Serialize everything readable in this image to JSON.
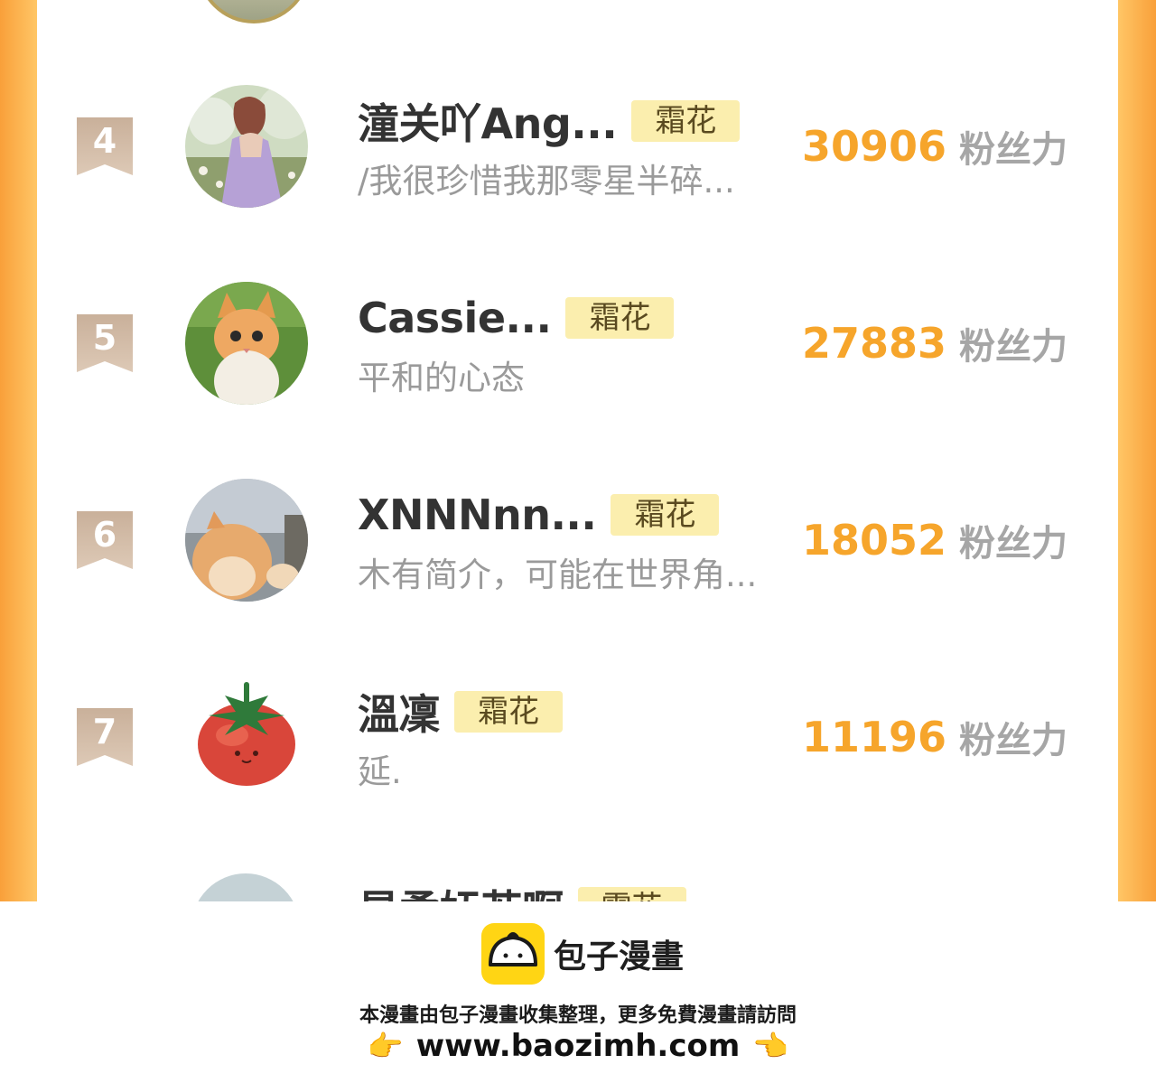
{
  "leaderboard": [
    {
      "rank": "4",
      "name": "潼关吖Ang...",
      "tag": "霜花",
      "bio": "/我很珍惜我那零星半碎...",
      "score": "30906",
      "unit": "粉丝力"
    },
    {
      "rank": "5",
      "name": "Cassie...",
      "tag": "霜花",
      "bio": "平和的心态",
      "score": "27883",
      "unit": "粉丝力"
    },
    {
      "rank": "6",
      "name": "XNNNnn...",
      "tag": "霜花",
      "bio": "木有简介，可能在世界角...",
      "score": "18052",
      "unit": "粉丝力"
    },
    {
      "rank": "7",
      "name": "溫凜",
      "tag": "霜花",
      "bio": "延.",
      "score": "11196",
      "unit": "粉丝力"
    }
  ],
  "partial_row": {
    "name": "星柔妩若啊",
    "tag": "霜花"
  },
  "footer": {
    "brand": "包子漫畫",
    "notice": "本漫畫由包子漫畫收集整理，更多免費漫畫請訪問",
    "url": "www.baozimh.com",
    "hand_left": "👉",
    "hand_right": "👈"
  },
  "colors": {
    "score": "#f6a52b",
    "tag_bg": "#fbeeae",
    "side": "#f9a03a",
    "rank_badge": "#c9ae96"
  }
}
